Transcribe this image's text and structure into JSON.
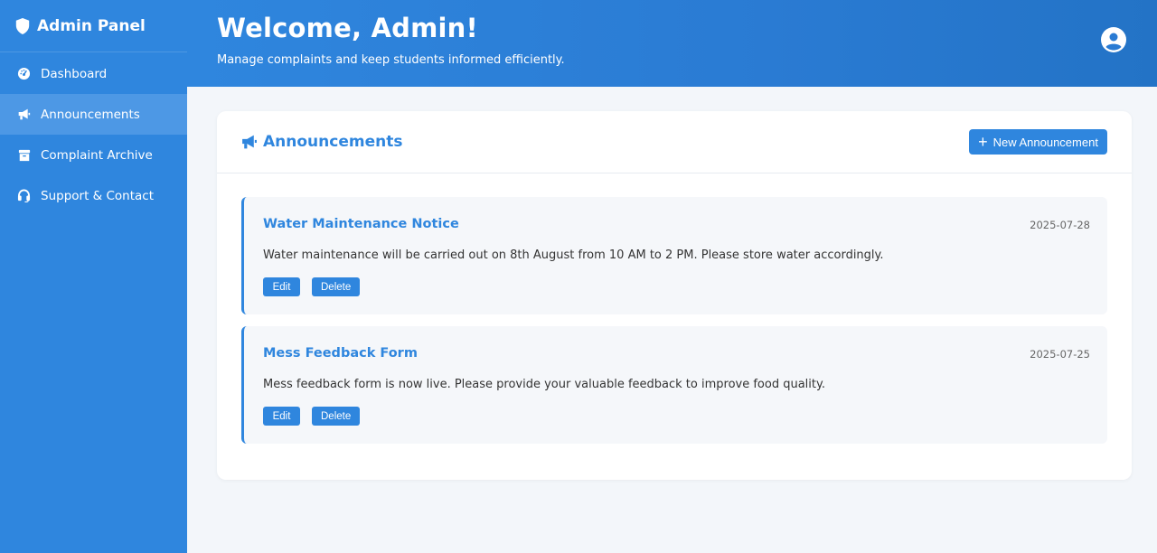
{
  "sidebar": {
    "brand": "Admin Panel",
    "items": [
      {
        "label": "Dashboard",
        "icon": "dashboard-icon"
      },
      {
        "label": "Announcements",
        "icon": "megaphone-icon",
        "active": true
      },
      {
        "label": "Complaint Archive",
        "icon": "archive-icon"
      },
      {
        "label": "Support & Contact",
        "icon": "headset-icon"
      }
    ]
  },
  "header": {
    "title": "Welcome, Admin!",
    "subtitle": "Manage complaints and keep students informed efficiently.",
    "user_icon": "user-circle-icon"
  },
  "panel": {
    "title": "Announcements",
    "new_button": "New Announcement",
    "announcements": [
      {
        "title": "Water Maintenance Notice",
        "date": "2025-07-28",
        "body": "Water maintenance will be carried out on 8th August from 10 AM to 2 PM. Please store water accordingly.",
        "edit": "Edit",
        "delete": "Delete"
      },
      {
        "title": "Mess Feedback Form",
        "date": "2025-07-25",
        "body": "Mess feedback form is now live. Please provide your valuable feedback to improve food quality.",
        "edit": "Edit",
        "delete": "Delete"
      }
    ]
  },
  "colors": {
    "primary": "#2f86de",
    "sidebar_active": "#4d98e5",
    "background": "#f3f6fa"
  }
}
